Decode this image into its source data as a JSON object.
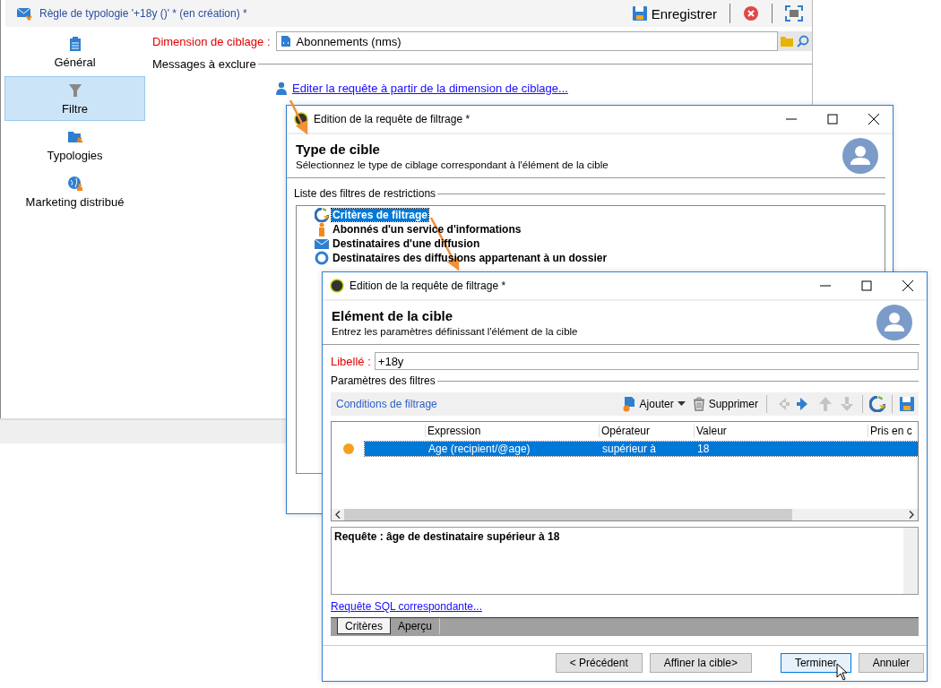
{
  "main_window": {
    "title": "Règle de typologie '+18y ()' * (en création) *",
    "save_button": "Enregistrer",
    "sidebar": [
      {
        "label": "Général",
        "kind": "general",
        "selected": false
      },
      {
        "label": "Filtre",
        "kind": "filter",
        "selected": true
      },
      {
        "label": "Typologies",
        "kind": "typologies",
        "selected": false
      },
      {
        "label": "Marketing distribué",
        "kind": "marketing",
        "selected": false
      }
    ],
    "targeting_dimension": {
      "label": "Dimension de ciblage :",
      "value": "Abonnements (nms)"
    },
    "exclude_section": "Messages à exclure",
    "edit_query_link": "Editer la requête à partir de la dimension de ciblage..."
  },
  "target_type_dialog": {
    "title": "Edition de la requête de filtrage *",
    "heading": "Type de cible",
    "subheading": "Sélectionnez le type de ciblage correspondant à l'élément de la cible",
    "list_label": "Liste des filtres de restrictions",
    "filters": [
      {
        "label": "Critères de filtrage",
        "kind": "criteria",
        "selected": true
      },
      {
        "label": "Abonnés d'un service d'informations",
        "kind": "subscribers",
        "selected": false
      },
      {
        "label": "Destinataires d'une diffusion",
        "kind": "delivery",
        "selected": false
      },
      {
        "label": "Destinataires des diffusions appartenant à un dossier",
        "kind": "folder",
        "selected": false
      }
    ]
  },
  "target_element_dialog": {
    "title": "Edition de la requête de filtrage *",
    "heading": "Elément de la cible",
    "subheading": "Entrez les paramètres définissant l'élément de la cible",
    "label_field": {
      "label": "Libellé :",
      "value": "+18y"
    },
    "params_label": "Paramètres des filtres",
    "conditions_label": "Conditions de filtrage",
    "add_button": "Ajouter",
    "delete_button": "Supprimer",
    "nav_buttons": [
      {
        "kind": "left",
        "disabled": true
      },
      {
        "kind": "right",
        "disabled": false
      },
      {
        "kind": "up",
        "disabled": true
      },
      {
        "kind": "down",
        "disabled": true
      }
    ],
    "table": {
      "columns": [
        "Expression",
        "Opérateur",
        "Valeur",
        "Pris en c"
      ],
      "rows": [
        {
          "cells": [
            "Age (recipient/@age)",
            "supérieur à",
            "18"
          ],
          "selected": true
        }
      ]
    },
    "query_summary": "Requête : âge de destinataire supérieur à 18",
    "sql_link": "Requête SQL correspondante...",
    "tabs": [
      {
        "label": "Critères",
        "selected": true
      },
      {
        "label": "Aperçu",
        "selected": false
      }
    ],
    "buttons": [
      {
        "label": "< Précédent",
        "default": false
      },
      {
        "label": "Affiner la cible>",
        "default": false
      },
      {
        "label": "Terminer",
        "default": true
      },
      {
        "label": "Annuler",
        "default": false
      }
    ]
  }
}
